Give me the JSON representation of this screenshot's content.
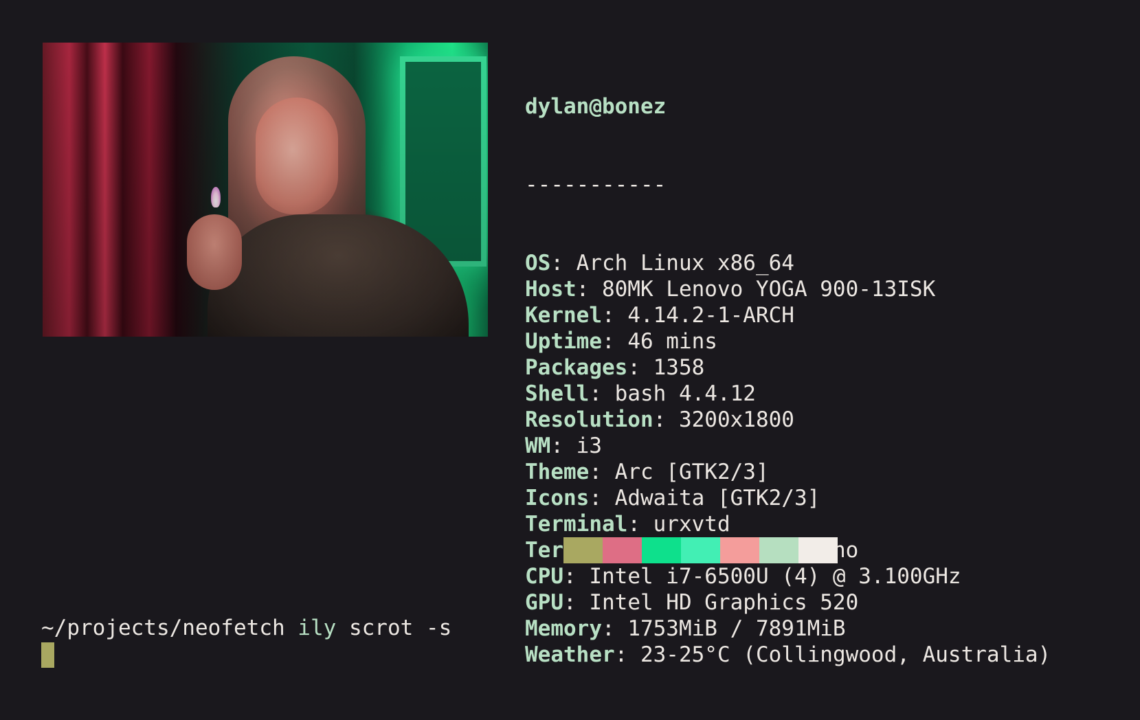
{
  "colors": {
    "background": "#1a181d",
    "foreground": "#ece7e2",
    "accent": "#b8e0c4",
    "cursor": "#a9a861"
  },
  "image": {
    "description_icon": "photo-image"
  },
  "info": {
    "title": "dylan@bonez",
    "underline": "-----------",
    "rows": [
      {
        "key": "OS",
        "sep": ": ",
        "value": "Arch Linux x86_64"
      },
      {
        "key": "Host",
        "sep": ": ",
        "value": "80MK Lenovo YOGA 900-13ISK"
      },
      {
        "key": "Kernel",
        "sep": ": ",
        "value": "4.14.2-1-ARCH"
      },
      {
        "key": "Uptime",
        "sep": ": ",
        "value": "46 mins"
      },
      {
        "key": "Packages",
        "sep": ": ",
        "value": "1358"
      },
      {
        "key": "Shell",
        "sep": ": ",
        "value": "bash 4.4.12"
      },
      {
        "key": "Resolution",
        "sep": ": ",
        "value": "3200x1800"
      },
      {
        "key": "WM",
        "sep": ": ",
        "value": "i3"
      },
      {
        "key": "Theme",
        "sep": ": ",
        "value": "Arc [GTK2/3]"
      },
      {
        "key": "Icons",
        "sep": ": ",
        "value": "Adwaita [GTK2/3]"
      },
      {
        "key": "Terminal",
        "sep": ": ",
        "value": "urxvtd"
      },
      {
        "key": "Terminal Font",
        "sep": ": ",
        "value": "Roboto Mono"
      },
      {
        "key": "CPU",
        "sep": ": ",
        "value": "Intel i7-6500U (4) @ 3.100GHz"
      },
      {
        "key": "GPU",
        "sep": ": ",
        "value": "Intel HD Graphics 520"
      },
      {
        "key": "Memory",
        "sep": ": ",
        "value": "1753MiB / 7891MiB"
      },
      {
        "key": "Weather",
        "sep": ": ",
        "value": "23-25°C (Collingwood, Australia)"
      }
    ]
  },
  "palette": [
    "#a9a861",
    "#de6e85",
    "#0ee08c",
    "#42efb4",
    "#f49d9b",
    "#b6dfc0",
    "#f2ede8"
  ],
  "prompt": {
    "path": "~/projects/neofetch",
    "command": "ily",
    "args": "scrot -s"
  }
}
